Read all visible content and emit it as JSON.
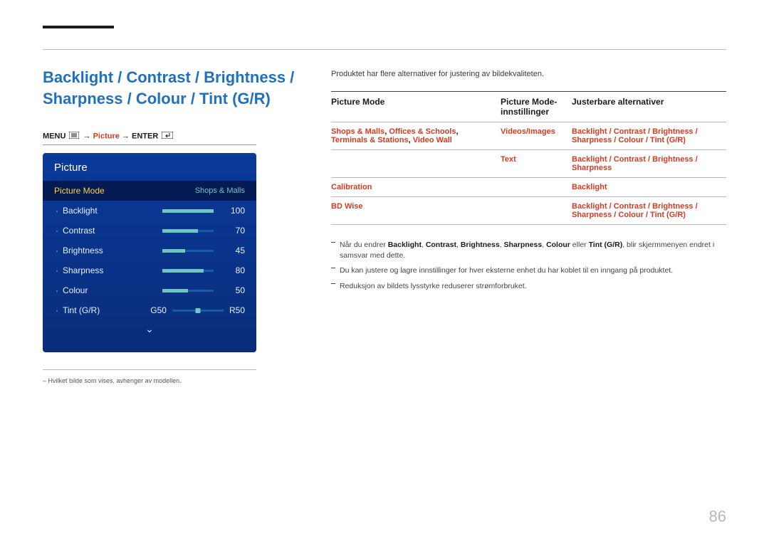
{
  "heading": "Backlight / Contrast / Brightness / Sharpness / Colour / Tint (G/R)",
  "path": {
    "a": "MENU",
    "b": "Picture",
    "c": "ENTER"
  },
  "osd": {
    "title": "Picture",
    "modeLabel": "Picture Mode",
    "modeValue": "Shops & Malls",
    "rows": [
      {
        "label": "Backlight",
        "value": "100",
        "pct": 100
      },
      {
        "label": "Contrast",
        "value": "70",
        "pct": 70
      },
      {
        "label": "Brightness",
        "value": "45",
        "pct": 45
      },
      {
        "label": "Sharpness",
        "value": "80",
        "pct": 80
      },
      {
        "label": "Colour",
        "value": "50",
        "pct": 50
      }
    ],
    "tint": {
      "label": "Tint (G/R)",
      "g": "G50",
      "r": "R50"
    }
  },
  "footnote": "Hvilket bilde som vises, avhenger av modellen.",
  "intro": "Produktet har flere alternativer for justering av bildekvaliteten.",
  "table": {
    "headers": {
      "c1": "Picture Mode",
      "c2": "Picture Mode-innstillinger",
      "c3": "Justerbare alternativer"
    },
    "rows": [
      {
        "c1": [
          "Shops & Malls",
          ", ",
          "Offices & Schools",
          ", ",
          "Terminals & Stations",
          ", ",
          "Video Wall"
        ],
        "c2": [
          "Videos/Images"
        ],
        "c3seg": [
          "Backlight",
          "Contrast",
          "Brightness",
          "Sharpness",
          "Colour",
          "Tint (G/R)"
        ]
      },
      {
        "c1": [],
        "c2": [
          "Text"
        ],
        "c3seg": [
          "Backlight",
          "Contrast",
          "Brightness",
          "Sharpness"
        ]
      },
      {
        "c1": [
          "Calibration"
        ],
        "c2": [],
        "c3seg": [
          "Backlight"
        ]
      },
      {
        "c1": [
          "BD Wise"
        ],
        "c2": [],
        "c3seg": [
          "Backlight",
          "Contrast",
          "Brightness",
          "Sharpness",
          "Colour",
          "Tint (G/R)"
        ]
      }
    ]
  },
  "notes": {
    "n1a": "Når du endrer ",
    "n1terms": [
      "Backlight",
      "Contrast",
      "Brightness",
      "Sharpness",
      "Colour"
    ],
    "n1mid": " eller ",
    "n1last": "Tint (G/R)",
    "n1b": ", blir skjermmenyen endret i samsvar med dette.",
    "n2": "Du kan justere og lagre innstillinger for hver eksterne enhet du har koblet til en inngang på produktet.",
    "n3": "Reduksjon av bildets lysstyrke reduserer strømforbruket."
  },
  "pageNumber": "86"
}
